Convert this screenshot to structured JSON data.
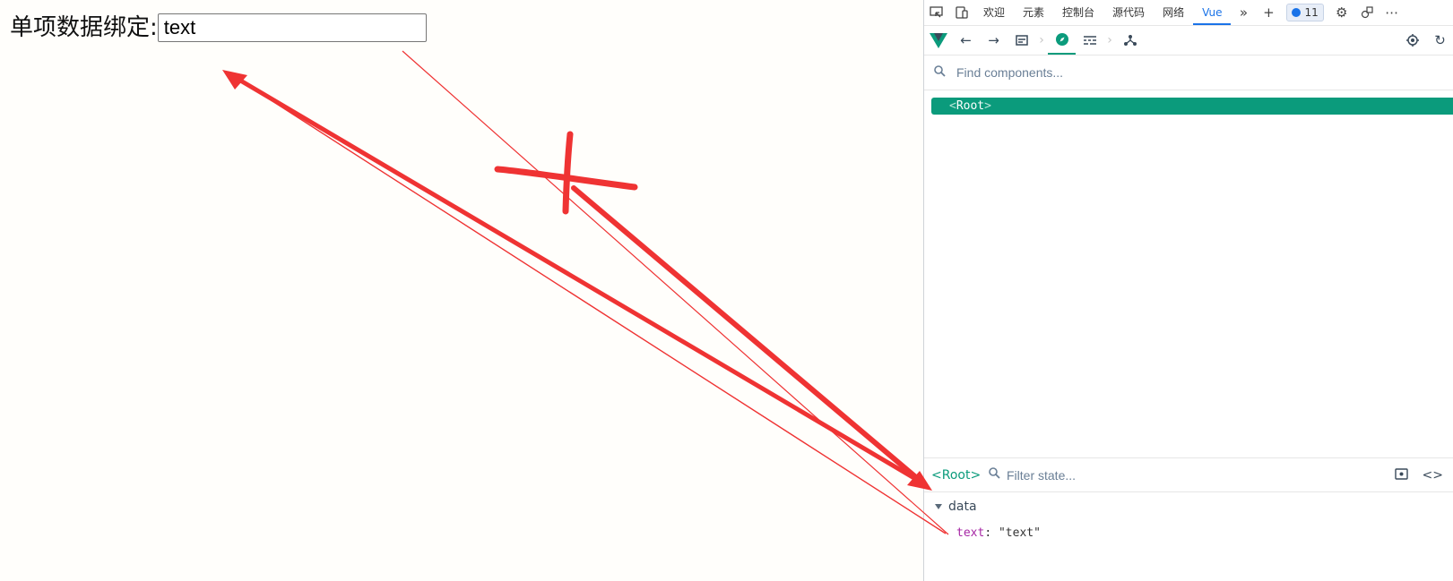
{
  "page": {
    "label": "单项数据绑定:",
    "input_value": "text"
  },
  "devtools": {
    "tabs": [
      "欢迎",
      "元素",
      "控制台",
      "源代码",
      "网络",
      "Vue"
    ],
    "active_tab": "Vue",
    "issues_count": "11",
    "component_search_placeholder": "Find components...",
    "tree_root": "Root",
    "state_root": "<Root>",
    "state_filter_placeholder": "Filter state...",
    "data_section": "data",
    "data_key": "text",
    "data_value": "\"text\""
  },
  "colors": {
    "vue_green": "#0b9b7c",
    "annotation_red": "#ef3333",
    "tab_active": "#1a73e8"
  }
}
